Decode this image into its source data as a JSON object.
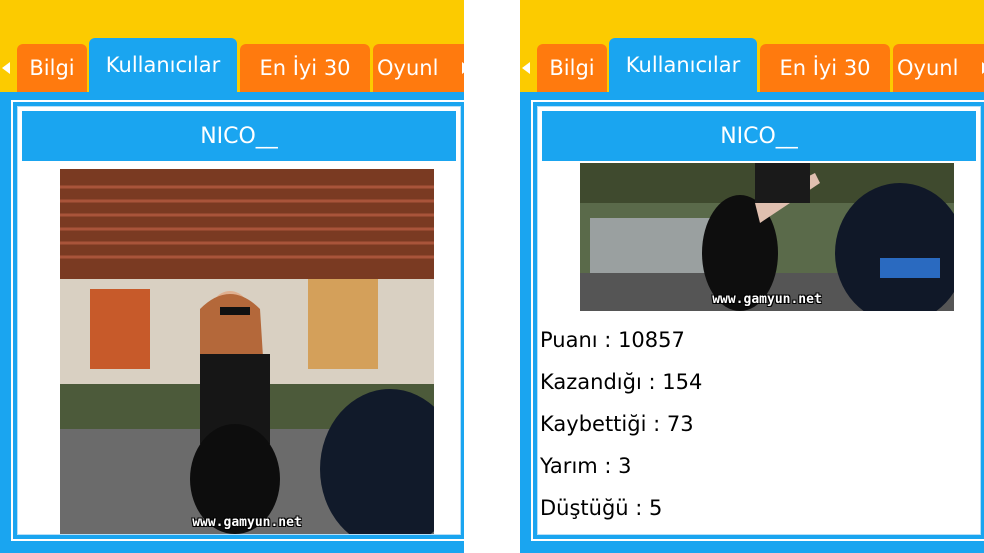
{
  "tabs": [
    {
      "label": "Bilgi",
      "active": false
    },
    {
      "label": "Kullanıcılar",
      "active": true
    },
    {
      "label": "En İyi 30",
      "active": false
    },
    {
      "label": "Oyunl",
      "active": false
    }
  ],
  "profile": {
    "username": "NICO__",
    "photo_watermark": "www.gamyun.net"
  },
  "stats": [
    {
      "label": "Puanı",
      "value": "10857"
    },
    {
      "label": "Kazandığı",
      "value": "154"
    },
    {
      "label": "Kaybettiği",
      "value": "73"
    },
    {
      "label": "Yarım",
      "value": "3"
    },
    {
      "label": "Düştüğü",
      "value": "5"
    }
  ],
  "colors": {
    "top_bar": "#fccb00",
    "tab_active": "#1aa5f0",
    "tab_inactive": "#ff7a0e",
    "panel": "#1aa5f0"
  },
  "icons": {
    "tab_scroll_left": "triangle-left",
    "tab_scroll_right": "triangle-right"
  }
}
